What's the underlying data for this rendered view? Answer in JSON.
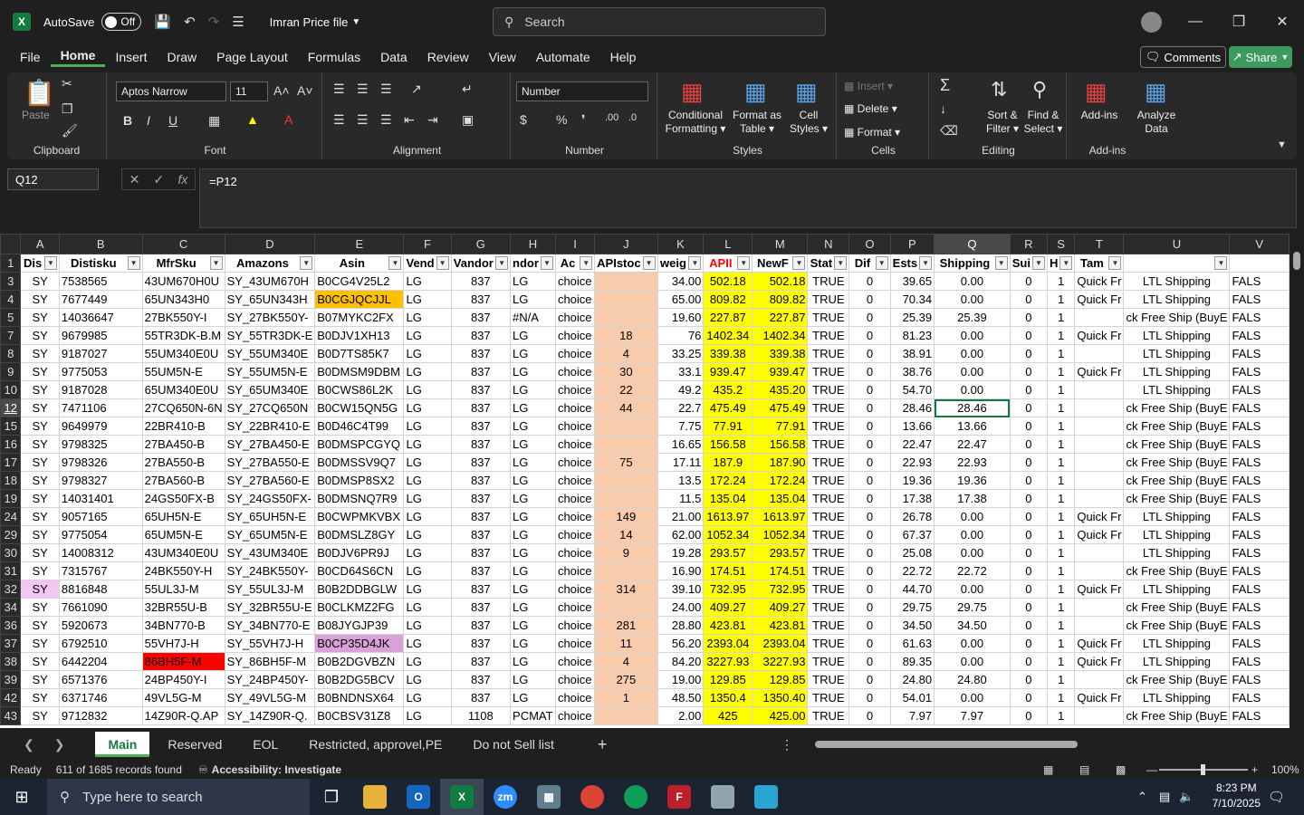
{
  "titlebar": {
    "autosave_label": "AutoSave",
    "autosave_state": "Off",
    "filename": "Imran Price file",
    "search_placeholder": "Search"
  },
  "menu": [
    "File",
    "Home",
    "Insert",
    "Draw",
    "Page Layout",
    "Formulas",
    "Data",
    "Review",
    "View",
    "Automate",
    "Help"
  ],
  "menu_active": "Home",
  "buttons": {
    "comments": "Comments",
    "share": "Share"
  },
  "ribbon": {
    "clipboard": {
      "label": "Clipboard",
      "paste": "Paste"
    },
    "font": {
      "label": "Font",
      "name": "Aptos Narrow",
      "size": "11"
    },
    "alignment": {
      "label": "Alignment"
    },
    "number": {
      "label": "Number",
      "format": "Number"
    },
    "styles": {
      "label": "Styles",
      "conditional": "Conditional",
      "formatting": "Formatting",
      "format_as": "Format as",
      "table": "Table",
      "cell": "Cell",
      "styles": "Styles"
    },
    "cells": {
      "label": "Cells",
      "insert": "Insert",
      "delete": "Delete",
      "format": "Format"
    },
    "editing": {
      "label": "Editing",
      "sort": "Sort &",
      "filter": "Filter",
      "find": "Find &",
      "select": "Select"
    },
    "addins": {
      "label": "Add-ins",
      "addins": "Add-ins",
      "analyze": "Analyze",
      "data": "Data"
    }
  },
  "formula": {
    "namebox": "Q12",
    "content": "=P12"
  },
  "columns": [
    "A",
    "B",
    "C",
    "D",
    "E",
    "F",
    "G",
    "H",
    "I",
    "J",
    "K",
    "L",
    "M",
    "N",
    "O",
    "P",
    "Q",
    "R",
    "S",
    "T",
    "U",
    "V"
  ],
  "selected_column": "Q",
  "headers": [
    "Dis",
    "Distisku",
    "MfrSku",
    "Amazons",
    "Asin",
    "Vend",
    "Vandor",
    "ndor",
    "Ac",
    "APIstoc",
    "weig",
    "APII",
    "NewF",
    "Stat",
    "Dif",
    "Ests",
    "Shipping",
    "Sui",
    "H",
    "Tam",
    "",
    ""
  ],
  "rows": [
    {
      "n": "3",
      "a": "SY",
      "b": "7538565",
      "c": "43UM670H0U",
      "d": "SY_43UM670H",
      "e": "B0CG4V25L2",
      "f": "LG",
      "g": "837",
      "h": "LG",
      "i": "choice",
      "j": "",
      "k": "34.00",
      "l": "502.18",
      "m": "502.18",
      "n2": "TRUE",
      "o": "0",
      "p": "39.65",
      "q": "0.00",
      "r": "0",
      "s": "1",
      "t": "Quick Fr",
      "u": "LTL Shipping",
      "v": "FALS"
    },
    {
      "n": "4",
      "a": "SY",
      "b": "7677449",
      "c": "65UN343H0",
      "d": "SY_65UN343H",
      "e": "B0CGJQCJJL",
      "f": "LG",
      "g": "837",
      "h": "LG",
      "i": "choice",
      "j": "",
      "k": "65.00",
      "l": "809.82",
      "m": "809.82",
      "n2": "TRUE",
      "o": "0",
      "p": "70.34",
      "q": "0.00",
      "r": "0",
      "s": "1",
      "t": "Quick Fr",
      "u": "LTL Shipping",
      "v": "FALS",
      "e_bg": "orange"
    },
    {
      "n": "5",
      "a": "SY",
      "b": "14036647",
      "c": "27BK550Y-I",
      "d": "SY_27BK550Y-",
      "e": "B07MYKC2FX",
      "f": "LG",
      "g": "837",
      "h": "#N/A",
      "i": "choice",
      "j": "",
      "k": "19.60",
      "l": "227.87",
      "m": "227.87",
      "n2": "TRUE",
      "o": "0",
      "p": "25.39",
      "q": "25.39",
      "r": "0",
      "s": "1",
      "t": "",
      "u": "ck Free Ship (BuyE",
      "v": "FALS"
    },
    {
      "n": "7",
      "a": "SY",
      "b": "9679985",
      "c": "55TR3DK-B.M",
      "d": "SY_55TR3DK-E",
      "e": "B0DJV1XH13",
      "f": "LG",
      "g": "837",
      "h": "LG",
      "i": "choice",
      "j": "18",
      "k": "76",
      "l": "1402.34",
      "m": "1402.34",
      "n2": "TRUE",
      "o": "0",
      "p": "81.23",
      "q": "0.00",
      "r": "0",
      "s": "1",
      "t": "Quick Fr",
      "u": "LTL Shipping",
      "v": "FALS"
    },
    {
      "n": "8",
      "a": "SY",
      "b": "9187027",
      "c": "55UM340E0U",
      "d": "SY_55UM340E",
      "e": "B0D7TS85K7",
      "f": "LG",
      "g": "837",
      "h": "LG",
      "i": "choice",
      "j": "4",
      "k": "33.25",
      "l": "339.38",
      "m": "339.38",
      "n2": "TRUE",
      "o": "0",
      "p": "38.91",
      "q": "0.00",
      "r": "0",
      "s": "1",
      "t": "",
      "u": "LTL Shipping",
      "v": "FALS"
    },
    {
      "n": "9",
      "a": "SY",
      "b": "9775053",
      "c": "55UM5N-E",
      "d": "SY_55UM5N-E",
      "e": "B0DMSM9DBM",
      "f": "LG",
      "g": "837",
      "h": "LG",
      "i": "choice",
      "j": "30",
      "k": "33.1",
      "l": "939.47",
      "m": "939.47",
      "n2": "TRUE",
      "o": "0",
      "p": "38.76",
      "q": "0.00",
      "r": "0",
      "s": "1",
      "t": "Quick Fr",
      "u": "LTL Shipping",
      "v": "FALS"
    },
    {
      "n": "10",
      "a": "SY",
      "b": "9187028",
      "c": "65UM340E0U",
      "d": "SY_65UM340E",
      "e": "B0CWS86L2K",
      "f": "LG",
      "g": "837",
      "h": "LG",
      "i": "choice",
      "j": "22",
      "k": "49.2",
      "l": "435.2",
      "m": "435.20",
      "n2": "TRUE",
      "o": "0",
      "p": "54.70",
      "q": "0.00",
      "r": "0",
      "s": "1",
      "t": "",
      "u": "LTL Shipping",
      "v": "FALS"
    },
    {
      "n": "12",
      "a": "SY",
      "b": "7471106",
      "c": "27CQ650N-6N",
      "d": "SY_27CQ650N",
      "e": "B0CW15QN5G",
      "f": "LG",
      "g": "837",
      "h": "LG",
      "i": "choice",
      "j": "44",
      "k": "22.7",
      "l": "475.49",
      "m": "475.49",
      "n2": "TRUE",
      "o": "0",
      "p": "28.46",
      "q": "28.46",
      "r": "0",
      "s": "1",
      "t": "",
      "u": "ck Free Ship (BuyE",
      "v": "FALS",
      "sel": true
    },
    {
      "n": "15",
      "a": "SY",
      "b": "9649979",
      "c": "22BR410-B",
      "d": "SY_22BR410-E",
      "e": "B0D46C4T99",
      "f": "LG",
      "g": "837",
      "h": "LG",
      "i": "choice",
      "j": "",
      "k": "7.75",
      "l": "77.91",
      "m": "77.91",
      "n2": "TRUE",
      "o": "0",
      "p": "13.66",
      "q": "13.66",
      "r": "0",
      "s": "1",
      "t": "",
      "u": "ck Free Ship (BuyE",
      "v": "FALS"
    },
    {
      "n": "16",
      "a": "SY",
      "b": "9798325",
      "c": "27BA450-B",
      "d": "SY_27BA450-E",
      "e": "B0DMSPCGYQ",
      "f": "LG",
      "g": "837",
      "h": "LG",
      "i": "choice",
      "j": "",
      "k": "16.65",
      "l": "156.58",
      "m": "156.58",
      "n2": "TRUE",
      "o": "0",
      "p": "22.47",
      "q": "22.47",
      "r": "0",
      "s": "1",
      "t": "",
      "u": "ck Free Ship (BuyE",
      "v": "FALS"
    },
    {
      "n": "17",
      "a": "SY",
      "b": "9798326",
      "c": "27BA550-B",
      "d": "SY_27BA550-E",
      "e": "B0DMSSV9Q7",
      "f": "LG",
      "g": "837",
      "h": "LG",
      "i": "choice",
      "j": "75",
      "k": "17.11",
      "l": "187.9",
      "m": "187.90",
      "n2": "TRUE",
      "o": "0",
      "p": "22.93",
      "q": "22.93",
      "r": "0",
      "s": "1",
      "t": "",
      "u": "ck Free Ship (BuyE",
      "v": "FALS"
    },
    {
      "n": "18",
      "a": "SY",
      "b": "9798327",
      "c": "27BA560-B",
      "d": "SY_27BA560-E",
      "e": "B0DMSP8SX2",
      "f": "LG",
      "g": "837",
      "h": "LG",
      "i": "choice",
      "j": "",
      "k": "13.5",
      "l": "172.24",
      "m": "172.24",
      "n2": "TRUE",
      "o": "0",
      "p": "19.36",
      "q": "19.36",
      "r": "0",
      "s": "1",
      "t": "",
      "u": "ck Free Ship (BuyE",
      "v": "FALS"
    },
    {
      "n": "19",
      "a": "SY",
      "b": "14031401",
      "c": "24GS50FX-B",
      "d": "SY_24GS50FX-",
      "e": "B0DMSNQ7R9",
      "f": "LG",
      "g": "837",
      "h": "LG",
      "i": "choice",
      "j": "",
      "k": "11.5",
      "l": "135.04",
      "m": "135.04",
      "n2": "TRUE",
      "o": "0",
      "p": "17.38",
      "q": "17.38",
      "r": "0",
      "s": "1",
      "t": "",
      "u": "ck Free Ship (BuyE",
      "v": "FALS"
    },
    {
      "n": "24",
      "a": "SY",
      "b": "9057165",
      "c": "65UH5N-E",
      "d": "SY_65UH5N-E",
      "e": "B0CWPMKVBX",
      "f": "LG",
      "g": "837",
      "h": "LG",
      "i": "choice",
      "j": "149",
      "k": "21.00",
      "l": "1613.97",
      "m": "1613.97",
      "n2": "TRUE",
      "o": "0",
      "p": "26.78",
      "q": "0.00",
      "r": "0",
      "s": "1",
      "t": "Quick Fr",
      "u": "LTL Shipping",
      "v": "FALS"
    },
    {
      "n": "29",
      "a": "SY",
      "b": "9775054",
      "c": "65UM5N-E",
      "d": "SY_65UM5N-E",
      "e": "B0DMSLZ8GY",
      "f": "LG",
      "g": "837",
      "h": "LG",
      "i": "choice",
      "j": "14",
      "k": "62.00",
      "l": "1052.34",
      "m": "1052.34",
      "n2": "TRUE",
      "o": "0",
      "p": "67.37",
      "q": "0.00",
      "r": "0",
      "s": "1",
      "t": "Quick Fr",
      "u": "LTL Shipping",
      "v": "FALS"
    },
    {
      "n": "30",
      "a": "SY",
      "b": "14008312",
      "c": "43UM340E0U",
      "d": "SY_43UM340E",
      "e": "B0DJV6PR9J",
      "f": "LG",
      "g": "837",
      "h": "LG",
      "i": "choice",
      "j": "9",
      "k": "19.28",
      "l": "293.57",
      "m": "293.57",
      "n2": "TRUE",
      "o": "0",
      "p": "25.08",
      "q": "0.00",
      "r": "0",
      "s": "1",
      "t": "",
      "u": "LTL Shipping",
      "v": "FALS"
    },
    {
      "n": "31",
      "a": "SY",
      "b": "7315767",
      "c": "24BK550Y-H",
      "d": "SY_24BK550Y-",
      "e": "B0CD64S6CN",
      "f": "LG",
      "g": "837",
      "h": "LG",
      "i": "choice",
      "j": "",
      "k": "16.90",
      "l": "174.51",
      "m": "174.51",
      "n2": "TRUE",
      "o": "0",
      "p": "22.72",
      "q": "22.72",
      "r": "0",
      "s": "1",
      "t": "",
      "u": "ck Free Ship (BuyE",
      "v": "FALS"
    },
    {
      "n": "32",
      "a": "SY",
      "b": "8816848",
      "c": "55UL3J-M",
      "d": "SY_55UL3J-M",
      "e": "B0B2DDBGLW",
      "f": "LG",
      "g": "837",
      "h": "LG",
      "i": "choice",
      "j": "314",
      "k": "39.10",
      "l": "732.95",
      "m": "732.95",
      "n2": "TRUE",
      "o": "0",
      "p": "44.70",
      "q": "0.00",
      "r": "0",
      "s": "1",
      "t": "Quick Fr",
      "u": "LTL Shipping",
      "v": "FALS",
      "a_bg": "lpink"
    },
    {
      "n": "34",
      "a": "SY",
      "b": "7661090",
      "c": "32BR55U-B",
      "d": "SY_32BR55U-E",
      "e": "B0CLKMZ2FG",
      "f": "LG",
      "g": "837",
      "h": "LG",
      "i": "choice",
      "j": "",
      "k": "24.00",
      "l": "409.27",
      "m": "409.27",
      "n2": "TRUE",
      "o": "0",
      "p": "29.75",
      "q": "29.75",
      "r": "0",
      "s": "1",
      "t": "",
      "u": "ck Free Ship (BuyE",
      "v": "FALS"
    },
    {
      "n": "36",
      "a": "SY",
      "b": "5920673",
      "c": "34BN770-B",
      "d": "SY_34BN770-E",
      "e": "B08JYGJP39",
      "f": "LG",
      "g": "837",
      "h": "LG",
      "i": "choice",
      "j": "281",
      "k": "28.80",
      "l": "423.81",
      "m": "423.81",
      "n2": "TRUE",
      "o": "0",
      "p": "34.50",
      "q": "34.50",
      "r": "0",
      "s": "1",
      "t": "",
      "u": "ck Free Ship (BuyE",
      "v": "FALS"
    },
    {
      "n": "37",
      "a": "SY",
      "b": "6792510",
      "c": "55VH7J-H",
      "d": "SY_55VH7J-H",
      "e": "B0CP35D4JK",
      "f": "LG",
      "g": "837",
      "h": "LG",
      "i": "choice",
      "j": "11",
      "k": "56.20",
      "l": "2393.04",
      "m": "2393.04",
      "n2": "TRUE",
      "o": "0",
      "p": "61.63",
      "q": "0.00",
      "r": "0",
      "s": "1",
      "t": "Quick Fr",
      "u": "LTL Shipping",
      "v": "FALS",
      "e_bg": "pink"
    },
    {
      "n": "38",
      "a": "SY",
      "b": "6442204",
      "c": "86BH5F-M",
      "d": "SY_86BH5F-M",
      "e": "B0B2DGVBZN",
      "f": "LG",
      "g": "837",
      "h": "LG",
      "i": "choice",
      "j": "4",
      "k": "84.20",
      "l": "3227.93",
      "m": "3227.93",
      "n2": "TRUE",
      "o": "0",
      "p": "89.35",
      "q": "0.00",
      "r": "0",
      "s": "1",
      "t": "Quick Fr",
      "u": "LTL Shipping",
      "v": "FALS",
      "c_bg": "red"
    },
    {
      "n": "39",
      "a": "SY",
      "b": "6571376",
      "c": "24BP450Y-I",
      "d": "SY_24BP450Y-",
      "e": "B0B2DG5BCV",
      "f": "LG",
      "g": "837",
      "h": "LG",
      "i": "choice",
      "j": "275",
      "k": "19.00",
      "l": "129.85",
      "m": "129.85",
      "n2": "TRUE",
      "o": "0",
      "p": "24.80",
      "q": "24.80",
      "r": "0",
      "s": "1",
      "t": "",
      "u": "ck Free Ship (BuyE",
      "v": "FALS"
    },
    {
      "n": "42",
      "a": "SY",
      "b": "6371746",
      "c": "49VL5G-M",
      "d": "SY_49VL5G-M",
      "e": "B0BNDNSX64",
      "f": "LG",
      "g": "837",
      "h": "LG",
      "i": "choice",
      "j": "1",
      "k": "48.50",
      "l": "1350.4",
      "m": "1350.40",
      "n2": "TRUE",
      "o": "0",
      "p": "54.01",
      "q": "0.00",
      "r": "0",
      "s": "1",
      "t": "Quick Fr",
      "u": "LTL Shipping",
      "v": "FALS"
    },
    {
      "n": "43",
      "a": "SY",
      "b": "9712832",
      "c": "14Z90R-Q.AP",
      "d": "SY_14Z90R-Q.",
      "e": "B0CBSV31Z8",
      "f": "LG",
      "g": "1108",
      "h": "PCMAT",
      "i": "choice",
      "j": "",
      "k": "2.00",
      "l": "425",
      "m": "425.00",
      "n2": "TRUE",
      "o": "0",
      "p": "7.97",
      "q": "7.97",
      "r": "0",
      "s": "1",
      "t": "",
      "u": "ck Free Ship (BuyE",
      "v": "FALS"
    }
  ],
  "sheet_tabs": [
    "Main",
    "Reserved",
    "EOL",
    "Restricted, approvel,PE",
    "Do not Sell list"
  ],
  "active_tab": "Main",
  "status": {
    "ready": "Ready",
    "records": "611 of 1685 records found",
    "accessibility": "Accessibility: Investigate",
    "zoom": "100%"
  },
  "taskbar": {
    "search_placeholder": "Type here to search",
    "time": "8:23 PM",
    "date": "7/10/2025"
  },
  "colors": {
    "accent": "#107c41",
    "salmon": "#f8cbad",
    "yellow": "#ffff00"
  }
}
